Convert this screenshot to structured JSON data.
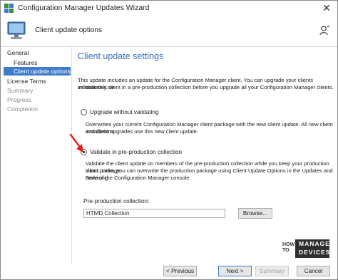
{
  "window": {
    "title": "Configuration Manager Updates Wizard"
  },
  "header": {
    "title": "Client update options"
  },
  "nav": {
    "items": [
      {
        "label": "General",
        "state": "normal"
      },
      {
        "label": "Features",
        "state": "normal"
      },
      {
        "label": "Client update options",
        "state": "active"
      },
      {
        "label": "License Terms",
        "state": "normal"
      },
      {
        "label": "Summary",
        "state": "dim"
      },
      {
        "label": "Progress",
        "state": "dim"
      },
      {
        "label": "Completion",
        "state": "dim"
      }
    ]
  },
  "main": {
    "heading": "Client update settings",
    "intro_line1": "This update includes an update for the Configuration Manager client. You can upgrade your clients immediately, or",
    "intro_line2": "validate this client in a pre-production collection before you upgrade all your Configuration Manager clients.",
    "option1": {
      "label": "Upgrade without validating",
      "selected": false,
      "desc_line1": "Overwrites your current Configuration Manager client package with the new client update. All new client installations",
      "desc_line2": "and client upgrades use this new client update."
    },
    "option2": {
      "label": "Validate in pre-production collection",
      "selected": true,
      "desc_line1": "Validate the client update on members of the pre-production collection while you keep your production client package",
      "desc_line2": "intact. Later, you can overwrite the production package using Client Update Options in the Updates and Servicing",
      "desc_line3": "node of the Configuration Manager console."
    },
    "collection_label": "Pre-production collection:",
    "collection_value": "HTMD Collection",
    "browse_label": "Browse..."
  },
  "footer": {
    "previous_label": "< Previous",
    "next_label": "Next >",
    "summary_label": "Summary",
    "cancel_label": "Cancel"
  },
  "watermark": {
    "how": "HOW",
    "to": "TO",
    "line1": "MANAGE",
    "line2": "DEVICES"
  },
  "colors": {
    "accent": "#3d7cc9",
    "heading": "#3770b8",
    "arrow": "#e02020"
  }
}
